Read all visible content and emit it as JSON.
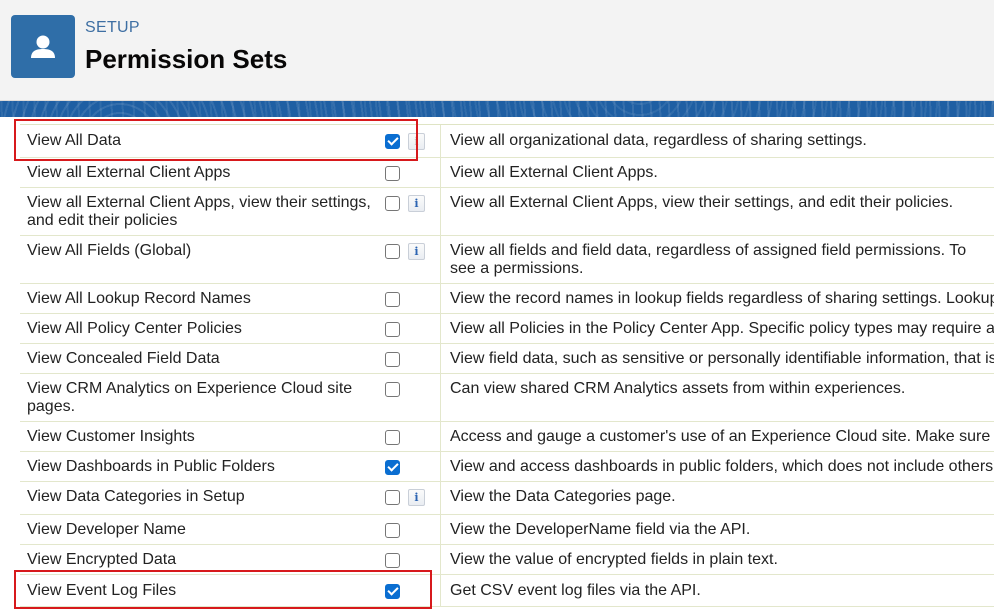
{
  "header": {
    "eyebrow": "SETUP",
    "title": "Permission Sets",
    "icon": "user-icon",
    "accent_color": "#2f6ea8"
  },
  "permissions": [
    {
      "label": "View All Data",
      "checked": true,
      "info": true,
      "desc": "View all organizational data, regardless of sharing settings."
    },
    {
      "label": "View all External Client Apps",
      "checked": false,
      "info": false,
      "desc": "View all External Client Apps."
    },
    {
      "label": "View all External Client Apps, view their settings, and edit their policies",
      "checked": false,
      "info": true,
      "desc": "View all External Client Apps, view their settings, and edit their policies."
    },
    {
      "label": "View All Fields (Global)",
      "checked": false,
      "info": true,
      "desc": "View all fields and field data, regardless of assigned field permissions. To see a permissions."
    },
    {
      "label": "View All Lookup Record Names",
      "checked": false,
      "info": false,
      "desc": "View the record names in lookup fields regardless of sharing settings. Lookup f"
    },
    {
      "label": "View All Policy Center Policies",
      "checked": false,
      "info": false,
      "desc": "View all Policies in the Policy Center App. Specific policy types may require add"
    },
    {
      "label": "View Concealed Field Data",
      "checked": false,
      "info": false,
      "desc": "View field data, such as sensitive or personally identifiable information, that is c"
    },
    {
      "label": "View CRM Analytics on Experience Cloud site pages.",
      "checked": false,
      "info": false,
      "desc": "Can view shared CRM Analytics assets from within experiences."
    },
    {
      "label": "View Customer Insights",
      "checked": false,
      "info": false,
      "desc": "Access and gauge a customer's use of an Experience Cloud site. Make sure th"
    },
    {
      "label": "View Dashboards in Public Folders",
      "checked": true,
      "info": false,
      "desc": "View and access dashboards in public folders, which does not include others' p"
    },
    {
      "label": "View Data Categories in Setup",
      "checked": false,
      "info": true,
      "desc": "View the Data Categories page."
    },
    {
      "label": "View Developer Name",
      "checked": false,
      "info": false,
      "desc": "View the DeveloperName field via the API."
    },
    {
      "label": "View Encrypted Data",
      "checked": false,
      "info": false,
      "desc": "View the value of encrypted fields in plain text."
    },
    {
      "label": "View Event Log Files",
      "checked": true,
      "info": false,
      "desc": "Get CSV event log files via the API."
    }
  ]
}
